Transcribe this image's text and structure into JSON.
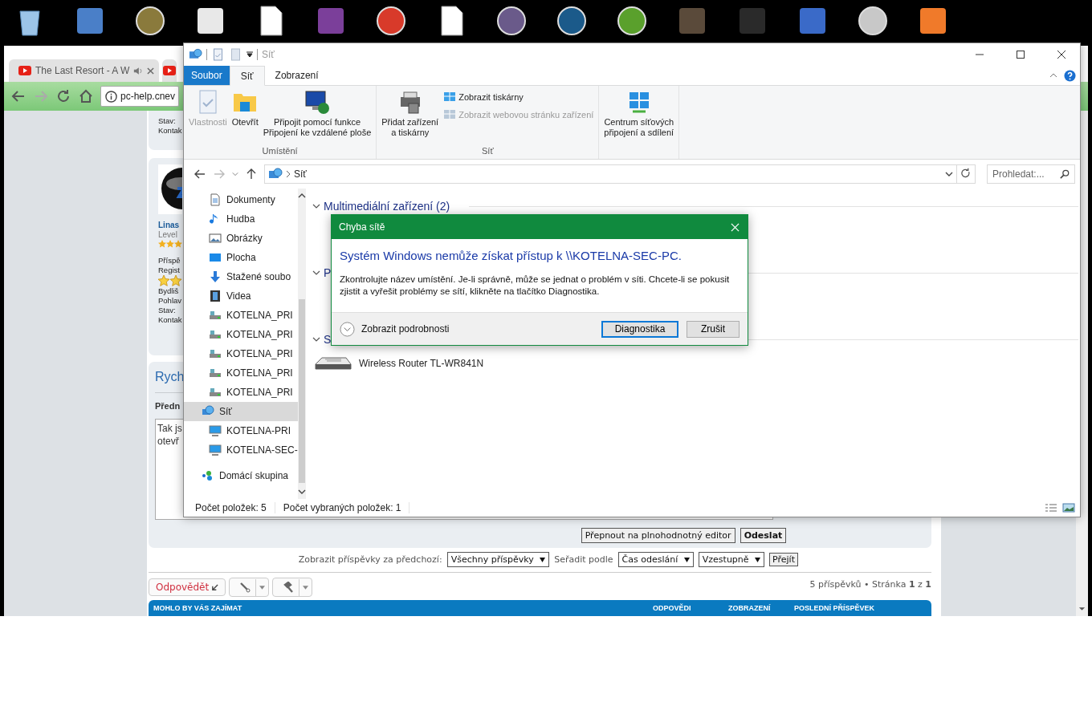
{
  "browser": {
    "tabs": [
      {
        "title": "The Last Resort - A W",
        "selected": true
      },
      {
        "selected": false
      }
    ],
    "address": "pc-help.cnev",
    "forum": {
      "card_top": [
        "Stav:",
        "Kontak"
      ],
      "profile": {
        "name": "Linas",
        "rank": "Level",
        "lines_a": [
          "Příspě",
          "Regist"
        ],
        "lines_b": [
          "Bydliš",
          "Pohlav",
          "Stav:",
          "Kontak"
        ]
      },
      "reply": {
        "title": "Rych",
        "label": "Předn",
        "value": [
          "Tak js",
          "otevř"
        ],
        "buttons": [
          {
            "label": "Přepnout na plnohodnotný editor",
            "primary": false
          },
          {
            "label": "Odeslat",
            "primary": true
          }
        ]
      },
      "filter": {
        "label": "Zobrazit příspěvky za předchozí:",
        "period": "Všechny příspěvky",
        "sort_label": "Seřadit podle",
        "sort": "Čas odeslání",
        "order": "Vzestupně",
        "go": "Přejít"
      },
      "reply_button": "Odpovědět",
      "pagination": "5 příspěvků • Stránka **1** z **1**",
      "related": {
        "title": "MOHLO BY VÁS ZAJÍMAT",
        "columns": [
          "ODPOVĚDI",
          "ZOBRAZENÍ",
          "POSLEDNÍ PŘÍSPĚVEK"
        ]
      }
    }
  },
  "explorer": {
    "title": "Síť",
    "ribbon_tabs": [
      {
        "label": "Soubor",
        "kind": "file",
        "selected": false
      },
      {
        "label": "Síť",
        "kind": "tab",
        "selected": true
      },
      {
        "label": "Zobrazení",
        "kind": "tab",
        "selected": false
      }
    ],
    "groups": [
      {
        "label": "Umístění",
        "commands": [
          {
            "label": "Vlastnosti",
            "kind": "properties",
            "disabled": true
          },
          {
            "label": "Otevřít",
            "kind": "open",
            "disabled": false
          },
          {
            "label": "Připojit pomocí funkce\nPřipojení ke vzdálené ploše",
            "kind": "remote",
            "disabled": false
          }
        ]
      },
      {
        "label": "Síť",
        "commands": [
          {
            "label": "Přidat zařízení\na tiskárny",
            "kind": "printer",
            "disabled": false
          }
        ],
        "small": [
          {
            "label": "Zobrazit tiskárny",
            "disabled": false
          },
          {
            "label": "Zobrazit webovou stránku zařízení",
            "disabled": true
          }
        ]
      },
      {
        "commands": [
          {
            "label": "Centrum síťových\npřipojení a sdílení",
            "kind": "network-center",
            "disabled": false
          }
        ]
      }
    ],
    "path": "Síť",
    "search": {
      "placeholder": "Prohledat:..."
    },
    "nav": {
      "pc_children": [
        {
          "label": "Dokumenty",
          "kind": "documents"
        },
        {
          "label": "Hudba",
          "kind": "music"
        },
        {
          "label": "Obrázky",
          "kind": "pictures"
        },
        {
          "label": "Plocha",
          "kind": "desktop"
        },
        {
          "label": "Stažené soubo",
          "kind": "downloads"
        },
        {
          "label": "Videa",
          "kind": "videos"
        },
        {
          "label": "KOTELNA_PRI",
          "kind": "drive"
        },
        {
          "label": "KOTELNA_PRI",
          "kind": "drive"
        },
        {
          "label": "KOTELNA_PRI",
          "kind": "drive"
        },
        {
          "label": "KOTELNA_PRI",
          "kind": "drive"
        },
        {
          "label": "KOTELNA_PRI",
          "kind": "drive"
        }
      ],
      "roots": [
        {
          "label": "Síť",
          "kind": "network",
          "selected": true,
          "children": [
            {
              "label": "KOTELNA-PRI",
              "selected": false
            },
            {
              "label": "KOTELNA-SEC-",
              "selected": false
            }
          ]
        },
        {
          "label": "Domácí skupina",
          "kind": "homegroup",
          "selected": false
        }
      ]
    },
    "content_groups": [
      {
        "title": "Multimediální zařízení (2)",
        "expanded": true
      },
      {
        "title": "P",
        "expanded": true
      },
      {
        "title": "S",
        "expanded": true,
        "items": [
          {
            "label": "Wireless Router TL-WR841N"
          }
        ]
      }
    ],
    "status": [
      "Počet položek: 5",
      "Počet vybraných položek: 1"
    ]
  },
  "dialog": {
    "title": "Chyba sítě",
    "heading": "Systém Windows nemůže získat přístup k \\\\KOTELNA-SEC-PC.",
    "message": "Zkontrolujte název umístění. Je-li správně, může se jednat o problém v síti. Chcete-li se pokusit zjistit a vyřešit problémy se sítí, klikněte na tlačítko Diagnostika.",
    "details": "Zobrazit podrobnosti",
    "buttons": [
      {
        "label": "Diagnostika",
        "default": true
      },
      {
        "label": "Zrušit",
        "default": false
      }
    ]
  }
}
